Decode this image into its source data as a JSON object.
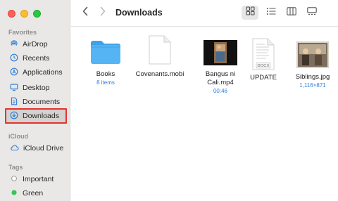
{
  "window": {
    "title": "Downloads"
  },
  "sidebar": {
    "favorites_title": "Favorites",
    "favorites": [
      {
        "label": "AirDrop",
        "icon": "airdrop-icon"
      },
      {
        "label": "Recents",
        "icon": "clock-icon"
      },
      {
        "label": "Applications",
        "icon": "applications-icon"
      },
      {
        "label": "Desktop",
        "icon": "desktop-icon"
      },
      {
        "label": "Documents",
        "icon": "document-icon"
      },
      {
        "label": "Downloads",
        "icon": "download-icon",
        "selected": true
      }
    ],
    "icloud_title": "iCloud",
    "icloud": [
      {
        "label": "iCloud Drive",
        "icon": "cloud-icon"
      }
    ],
    "tags_title": "Tags",
    "tags": [
      {
        "label": "Important",
        "color": "#ffffff"
      },
      {
        "label": "Green",
        "color": "#34c759"
      }
    ]
  },
  "toolbar": {
    "back_icon": "chevron-left-icon",
    "forward_icon": "chevron-right-icon",
    "views": [
      "icon-view",
      "list-view",
      "column-view",
      "gallery-view"
    ],
    "active_view": "icon-view"
  },
  "files": [
    {
      "name": "Books",
      "meta": "8 items",
      "kind": "folder"
    },
    {
      "name": "Covenants.mobi",
      "meta": "",
      "kind": "document"
    },
    {
      "name": "Bangus ni Cali.mp4",
      "meta": "00:46",
      "kind": "video"
    },
    {
      "name": "UPDATE",
      "meta": "",
      "kind": "docx",
      "badge": "DOCX"
    },
    {
      "name": "Siblings.jpg",
      "meta": "1,116×871",
      "kind": "photo"
    }
  ],
  "colors": {
    "accent": "#2b7de0",
    "highlight": "#e5332a"
  }
}
